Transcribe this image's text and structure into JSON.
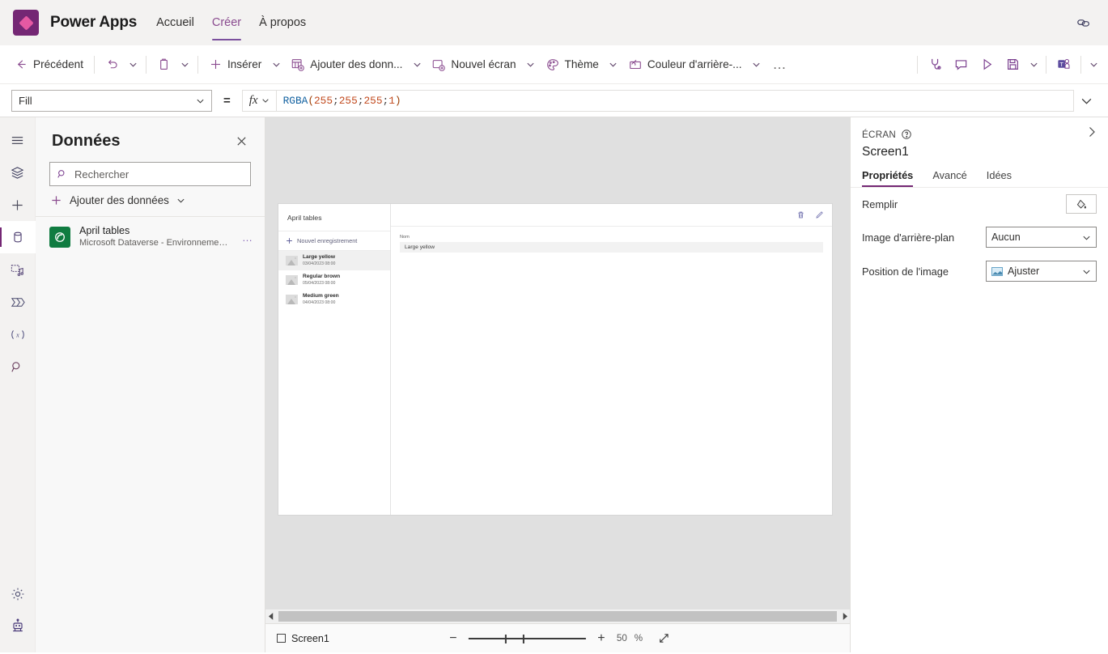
{
  "header": {
    "brand": "Power Apps",
    "nav": [
      {
        "label": "Accueil",
        "active": false
      },
      {
        "label": "Créer",
        "active": true
      },
      {
        "label": "À propos",
        "active": false
      }
    ],
    "link_icon": "link-icon"
  },
  "commandbar": {
    "back": "Précédent",
    "undo_icon": "undo-icon",
    "paste_icon": "paste-icon",
    "insert": "Insérer",
    "add_data": "Ajouter des donn...",
    "new_screen": "Nouvel écran",
    "theme": "Thème",
    "background_color": "Couleur d'arrière-...",
    "overflow": "…",
    "right_icons": [
      "app-checker-icon",
      "comment-icon",
      "preview-play-icon",
      "save-icon",
      "chevron-down-icon",
      "teams-publish-icon",
      "chevron-down-icon"
    ]
  },
  "formulabar": {
    "property": "Fill",
    "equals": "=",
    "fx": "fx",
    "formula_function": "RGBA",
    "formula_open": "(",
    "formula_args": [
      "255",
      "255",
      "255",
      "1"
    ],
    "formula_sep": "; ",
    "formula_close": ")",
    "formula_full": "RGBA(255; 255; 255; 1)"
  },
  "rail": {
    "items": [
      {
        "name": "hamburger-menu-icon",
        "active": false
      },
      {
        "name": "tree-view-icon",
        "active": false
      },
      {
        "name": "insert-plus-icon",
        "active": false
      },
      {
        "name": "data-cylinder-icon",
        "active": true
      },
      {
        "name": "media-icon",
        "active": false
      },
      {
        "name": "power-automate-icon",
        "active": false
      },
      {
        "name": "variables-icon",
        "active": false
      },
      {
        "name": "search-icon",
        "active": false
      }
    ],
    "bottom": [
      {
        "name": "settings-gear-icon"
      },
      {
        "name": "copilot-robot-icon"
      }
    ]
  },
  "datapanel": {
    "title": "Données",
    "close_icon": "close-icon",
    "search_placeholder": "Rechercher",
    "search_value": "",
    "add_data": "Ajouter des données",
    "sources": [
      {
        "name": "April tables",
        "subtitle": "Microsoft Dataverse - Environnement ac...",
        "more": "…"
      }
    ]
  },
  "canvas": {
    "gallery": {
      "title": "April tables",
      "new_record": "Nouvel enregistrement",
      "rows": [
        {
          "name": "Large yellow",
          "date": "03/04/2023 08:00",
          "selected": true
        },
        {
          "name": "Regular brown",
          "date": "05/04/2023 08:00",
          "selected": false
        },
        {
          "name": "Medium green",
          "date": "04/04/2023 08:00",
          "selected": false
        }
      ]
    },
    "form": {
      "delete_icon": "trash-icon",
      "edit_icon": "pencil-icon",
      "fields": [
        {
          "label": "Nom",
          "value": "Large yellow"
        }
      ]
    }
  },
  "statusbar": {
    "screen_name": "Screen1",
    "zoom_minus": "−",
    "zoom_plus": "+",
    "zoom_value": "50",
    "zoom_unit": "%",
    "fit_icon": "fit-screen-icon"
  },
  "properties": {
    "kind": "ÉCRAN",
    "help_icon": "help-circle-icon",
    "expand_icon": "chevron-right-icon",
    "name": "Screen1",
    "tabs": [
      {
        "label": "Propriétés",
        "active": true
      },
      {
        "label": "Avancé",
        "active": false
      },
      {
        "label": "Idées",
        "active": false
      }
    ],
    "rows": [
      {
        "label": "Remplir",
        "control": "fill-button"
      },
      {
        "label": "Image d'arrière-plan",
        "value": "Aucun"
      },
      {
        "label": "Position de l'image",
        "value": "Ajuster"
      }
    ]
  },
  "colors": {
    "brand_purple": "#742774",
    "accent_magenta": "#e659a3",
    "dataverse_green": "#107c41",
    "canvas_bg": "#e0e0e0"
  }
}
